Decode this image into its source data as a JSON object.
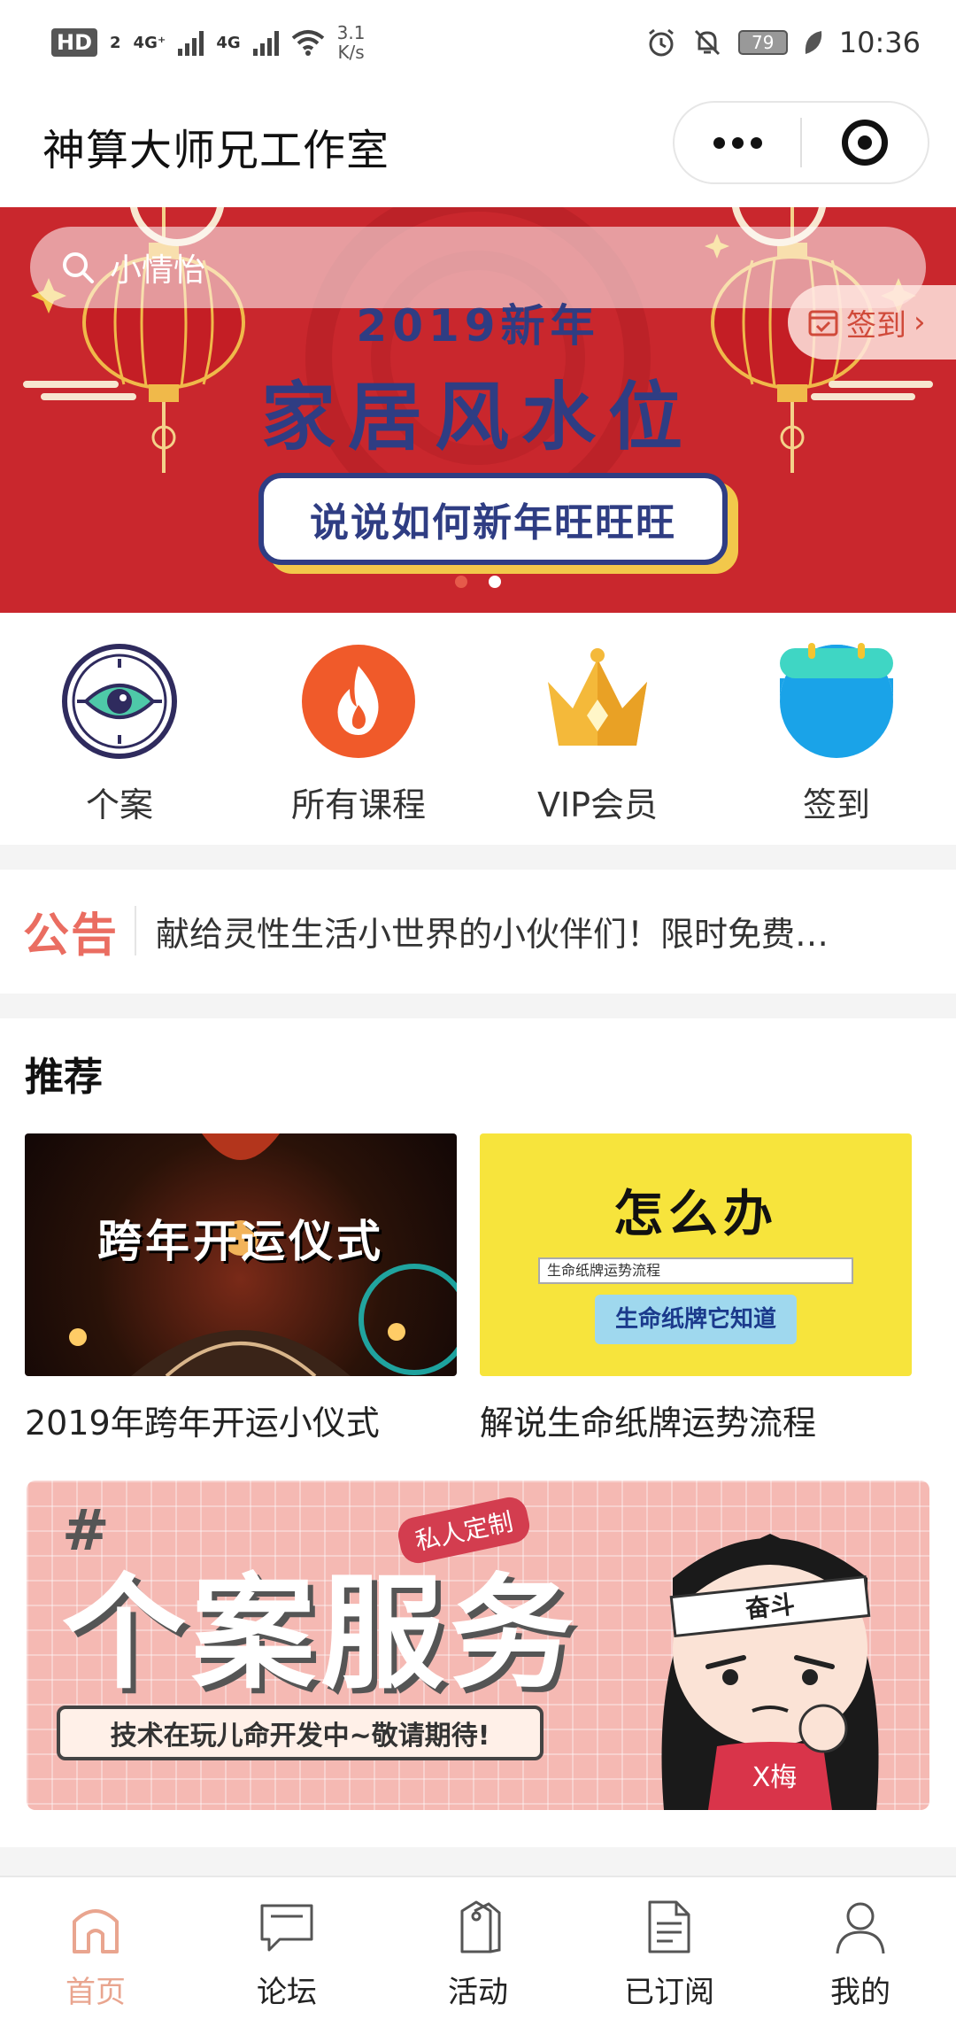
{
  "status_bar": {
    "hd": "HD",
    "sim": "2",
    "net1": "4G⁺",
    "net2": "4G",
    "speed_value": "3.1",
    "speed_unit": "K/s",
    "battery": "79",
    "time": "10:36"
  },
  "navbar": {
    "title": "神算大师兄工作室"
  },
  "banner": {
    "search_text": "小情怡",
    "signin_label": "签到",
    "subtitle": "2019新年",
    "title": "家居风水位",
    "pill": "说说如何新年旺旺旺",
    "slide_count": 2,
    "active_slide": 1,
    "colors": {
      "bg": "#c9272d",
      "text": "#2f3d83",
      "accent": "#f2c84b"
    }
  },
  "quick_grid": [
    {
      "label": "个案",
      "icon": "eye-clock-icon"
    },
    {
      "label": "所有课程",
      "icon": "flame-icon"
    },
    {
      "label": "VIP会员",
      "icon": "crown-icon"
    },
    {
      "label": "签到",
      "icon": "calendar-icon"
    }
  ],
  "notice": {
    "tag": "公告",
    "text": "献给灵性生活小世界的小伙伴们！限时免费…"
  },
  "recommend": {
    "title": "推荐",
    "cards": [
      {
        "caption": "2019年跨年开运小仪式",
        "image_text": "跨年开运仪式"
      },
      {
        "caption": "解说生命纸牌运势流程",
        "image_text": "怎么办",
        "search_text": "生命纸牌运势流程",
        "button_text": "生命纸牌它知道"
      }
    ]
  },
  "service_banner": {
    "hash": "#",
    "title": "个案服务",
    "tag": "私人定制",
    "subtitle": "技术在玩儿命开发中~敬请期待!",
    "headband": "奋斗",
    "shirt": "X梅"
  },
  "tabbar": {
    "active": 0,
    "active_color": "#e9a58f",
    "tabs": [
      {
        "label": "首页",
        "icon": "home-icon"
      },
      {
        "label": "论坛",
        "icon": "chat-icon"
      },
      {
        "label": "活动",
        "icon": "tag-icon"
      },
      {
        "label": "已订阅",
        "icon": "document-icon"
      },
      {
        "label": "我的",
        "icon": "user-icon"
      }
    ]
  }
}
